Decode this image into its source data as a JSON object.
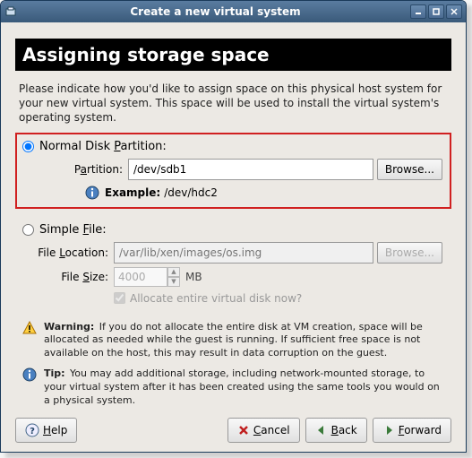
{
  "window": {
    "title": "Create a new virtual system"
  },
  "heading": "Assigning storage space",
  "intro": "Please indicate how you'd like to assign space on this physical host system for your new virtual system. This space will be used to install the virtual system's operating system.",
  "partition": {
    "radio_label_pre": "Normal Disk ",
    "radio_label_u": "P",
    "radio_label_post": "artition:",
    "field_label_pre": "P",
    "field_label_u": "a",
    "field_label_post": "rtition:",
    "value": "/dev/sdb1",
    "browse": "Browse...",
    "example_label": "Example:",
    "example_value": "/dev/hdc2",
    "selected": true
  },
  "file": {
    "radio_label_pre": "Simple ",
    "radio_label_u": "F",
    "radio_label_post": "ile:",
    "loc_label_pre": "File ",
    "loc_label_u": "L",
    "loc_label_post": "ocation:",
    "loc_placeholder": "/var/lib/xen/images/os.img",
    "browse": "Browse...",
    "size_label_pre": "File ",
    "size_label_u": "S",
    "size_label_post": "ize:",
    "size_value": "4000",
    "size_unit": "MB",
    "allocate_label": "Allocate entire virtual disk now?",
    "allocate_checked": true,
    "selected": false
  },
  "warning": {
    "label": "Warning:",
    "text": "If you do not allocate the entire disk at VM creation, space will be allocated as needed while the guest is running. If sufficient free space is not available on the host, this may result in data corruption on the guest."
  },
  "tip": {
    "label": "Tip:",
    "text": "You may add additional storage, including network-mounted storage, to your virtual system after it has been created using the same tools you would on a physical system."
  },
  "buttons": {
    "help_u": "H",
    "help_rest": "elp",
    "cancel_u": "C",
    "cancel_rest": "ancel",
    "back_u": "B",
    "back_rest": "ack",
    "forward_u": "F",
    "forward_rest": "orward"
  }
}
